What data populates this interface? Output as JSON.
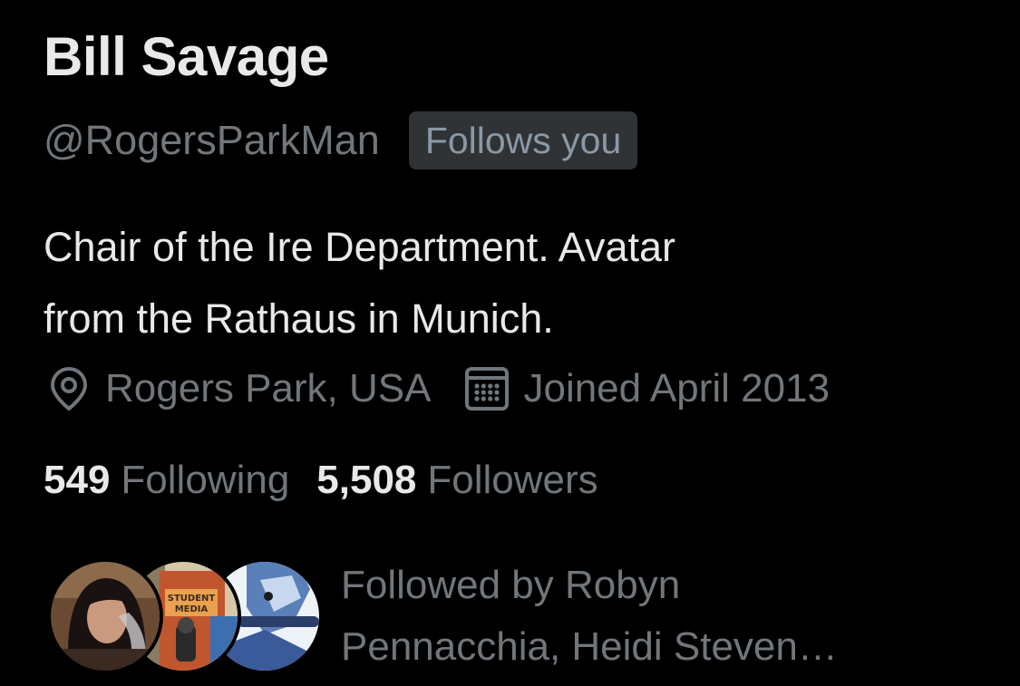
{
  "profile": {
    "name": "Bill Savage",
    "handle": "@RogersParkMan",
    "follows_badge": "Follows you",
    "bio_line1": "Chair of the Ire Department. Avatar",
    "bio_line2": "from the Rathaus in Munich.",
    "location": "Rogers Park, USA",
    "location_icon": "location-pin-icon",
    "joined": "Joined April 2013",
    "joined_icon": "calendar-icon"
  },
  "stats": {
    "following_count": "549",
    "following_label": "Following",
    "followers_count": "5,508",
    "followers_label": "Followers"
  },
  "followed_by": {
    "line1": "Followed by Robyn",
    "line2": "Pennacchia, Heidi Steven…",
    "avatar_badge_text": "STUDENT MEDIA"
  },
  "colors": {
    "background": "#000000",
    "primary_text": "#e7e9ea",
    "secondary_text": "#71767b",
    "badge_background": "#2f3336",
    "badge_text": "#8b98a5"
  }
}
